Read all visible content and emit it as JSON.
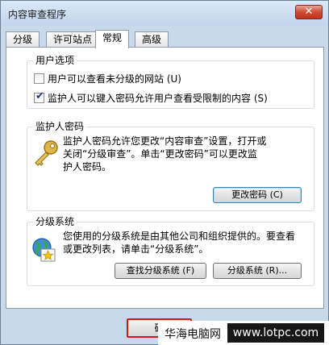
{
  "window": {
    "title": "内容审查程序",
    "close_glyph": "✕"
  },
  "tabs": [
    {
      "label": "分级"
    },
    {
      "label": "许可站点"
    },
    {
      "label": "常规",
      "active": true
    },
    {
      "label": "高级"
    }
  ],
  "user_options": {
    "title": "用户选项",
    "checkboxes": [
      {
        "label": "用户可以查看未分级的网站 (U)",
        "checked": false
      },
      {
        "label": "监护人可以键入密码允许用户查看受限制的内容 (S)",
        "checked": true
      }
    ]
  },
  "supervisor_password": {
    "title": "监护人密码",
    "description": [
      "监护人密码允许您更改“内容审查”设置，打开或",
      "关闭“分级审查”。单击“更改密码”可以更改监",
      "护人密码。"
    ],
    "change_button": "更改密码 (C)",
    "icon": "key-icon"
  },
  "rating_systems": {
    "title": "分级系统",
    "description": [
      "您使用的分级系统是由其他公司和组织提供的。要查看",
      "或更改列表，请单击“分级系统”。"
    ],
    "find_button": "查找分级系统 (F)",
    "systems_button": "分级系统 (R)...",
    "icon": "globe-certificate-icon"
  },
  "footer": {
    "ok_label": "确"
  },
  "watermark": {
    "text": "华海电脑网",
    "url": "www.lotpc.com"
  }
}
